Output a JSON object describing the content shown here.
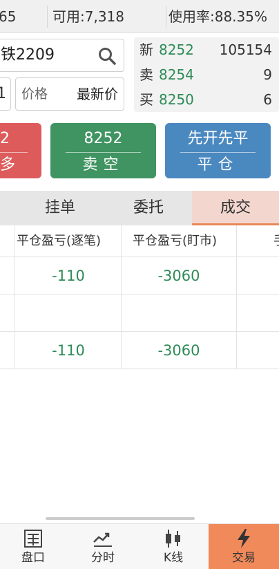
{
  "topbar": {
    "balance_fragment": "65",
    "available": "可用:7,318",
    "usage_rate": "使用率:88.35%"
  },
  "order": {
    "symbol": "铁2209",
    "quantity": "1",
    "price_label": "价格",
    "price_value": "最新价"
  },
  "quote": {
    "last_label": "新",
    "last_price": "8252",
    "last_volume": "105154",
    "ask_label": "卖",
    "ask_price": "8254",
    "ask_volume": "9",
    "bid_label": "买",
    "bid_price": "8250",
    "bid_volume": "6"
  },
  "actions": {
    "buy": {
      "price": "2",
      "label": "多"
    },
    "sell": {
      "price": "8252",
      "label": "卖空"
    },
    "close": {
      "mode": "先开先平",
      "label": "平仓"
    }
  },
  "tabs": [
    {
      "label": "挂单"
    },
    {
      "label": "委托"
    },
    {
      "label": "成交"
    }
  ],
  "table": {
    "headers": [
      "平仓盈亏(逐笔)",
      "平仓盈亏(盯市)",
      "手"
    ],
    "rows": [
      {
        "pnl_per_trade": "-110",
        "pnl_mark_to_market": "-3060"
      },
      {
        "pnl_per_trade": "",
        "pnl_mark_to_market": ""
      },
      {
        "pnl_per_trade": "-110",
        "pnl_mark_to_market": "-3060"
      }
    ]
  },
  "bottom_nav": [
    {
      "label": "盘口",
      "icon": "orderbook-icon"
    },
    {
      "label": "分时",
      "icon": "timeshare-icon"
    },
    {
      "label": "K线",
      "icon": "candlestick-icon"
    },
    {
      "label": "交易",
      "icon": "lightning-icon",
      "active": true
    }
  ],
  "colors": {
    "buy": "#de5b5b",
    "sell": "#3f9461",
    "close": "#4a88c0",
    "active_tab": "#f3d7cf",
    "active_nav": "#f08a5a",
    "positive_green": "#2e8b57"
  }
}
